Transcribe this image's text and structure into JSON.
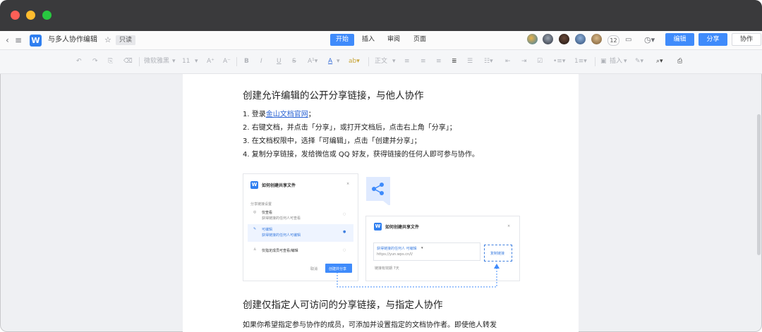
{
  "topbar": {
    "doc_title": "与多人协作编辑",
    "readonly_badge": "只读",
    "menu_tabs": [
      {
        "label": "开始",
        "active": true
      },
      {
        "label": "插入",
        "active": false
      },
      {
        "label": "审阅",
        "active": false
      },
      {
        "label": "页面",
        "active": false
      }
    ],
    "collaborator_count": "12",
    "edit_button": "编辑",
    "share_button": "分享",
    "collab_button": "协作",
    "accent_color": "#3f8bfb"
  },
  "toolbar": {
    "font_name": "微软雅黑",
    "font_size": "11",
    "style_label": "正文",
    "insert_label": "插入"
  },
  "document": {
    "heading1": "创建允许编辑的公开分享链接，与他人协作",
    "steps": [
      {
        "prefix": "1. 登录",
        "link": "金山文档官网",
        "suffix": "；"
      },
      {
        "text": "2. 右键文档，并点击「分享」，或打开文档后，点击右上角「分享」；"
      },
      {
        "text": "3. 在文档权限中，选择「可编辑」，点击「创建并分享」；"
      },
      {
        "text": "4. 复制分享链接，发给微信或 QQ 好友，获得链接的任何人即可参与协作。"
      }
    ],
    "heading2": "创建仅指定人可访问的分享链接，与指定人协作",
    "paragraph": "如果你希望指定参与协作的成员，可添加并设置指定的文档协作者。即使他人转发"
  },
  "illustration": {
    "card1": {
      "title": "如何创建共享文件",
      "section_label": "分享链接设置",
      "options": [
        {
          "title": "仅查看",
          "desc": "获得链接的任何人可查看",
          "selected": false
        },
        {
          "title": "可编辑",
          "desc": "获得链接的任何人可编辑",
          "selected": true
        },
        {
          "title": "仅指定成员可查看/编辑",
          "desc": "",
          "selected": false
        }
      ],
      "cancel": "取消",
      "create": "创建并分享"
    },
    "card2": {
      "title": "如何创建共享文件",
      "perm": "获得链接的任何人 可编辑",
      "url": "https://yun.wps.cn/l/",
      "copy": "复制链接",
      "expiry": "链接有效期  7天"
    }
  }
}
